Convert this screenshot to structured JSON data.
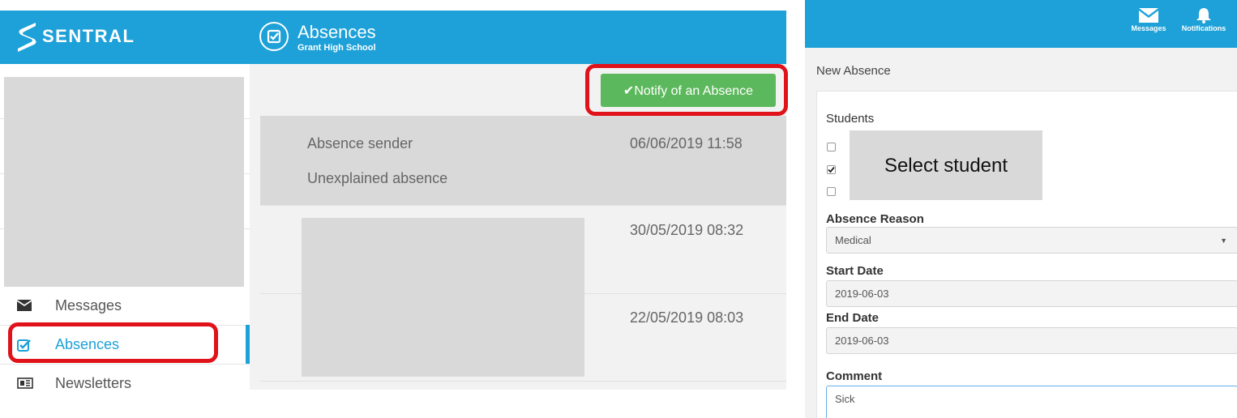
{
  "left": {
    "brand": "SENTRAL",
    "header": {
      "title": "Absences",
      "subtitle": "Grant High School"
    },
    "sidebar": {
      "items": [
        {
          "label": "Messages"
        },
        {
          "label": "Absences"
        },
        {
          "label": "Newsletters"
        }
      ]
    },
    "notify_button": "✔Notify of an Absence",
    "list": [
      {
        "sender": "Absence sender",
        "status": "Unexplained absence",
        "datetime": "06/06/2019 11:58"
      },
      {
        "datetime": "30/05/2019 08:32"
      },
      {
        "datetime": "22/05/2019 08:03"
      }
    ]
  },
  "right": {
    "header": {
      "messages": "Messages",
      "notifications": "Notifications"
    },
    "page_title": "New Absence",
    "students_label": "Students",
    "students_overlay": "Select student",
    "students_checked": [
      false,
      true,
      false
    ],
    "reason": {
      "label": "Absence Reason",
      "value": "Medical"
    },
    "start_date": {
      "label": "Start Date",
      "value": "2019-06-03"
    },
    "end_date": {
      "label": "End Date",
      "value": "2019-06-03"
    },
    "comment": {
      "label": "Comment",
      "value": "Sick"
    }
  },
  "colors": {
    "brand_blue": "#1da1d8",
    "notify_green": "#5cb85c",
    "highlight_red": "#e0121a",
    "placeholder_gray": "#d9d9d9"
  }
}
